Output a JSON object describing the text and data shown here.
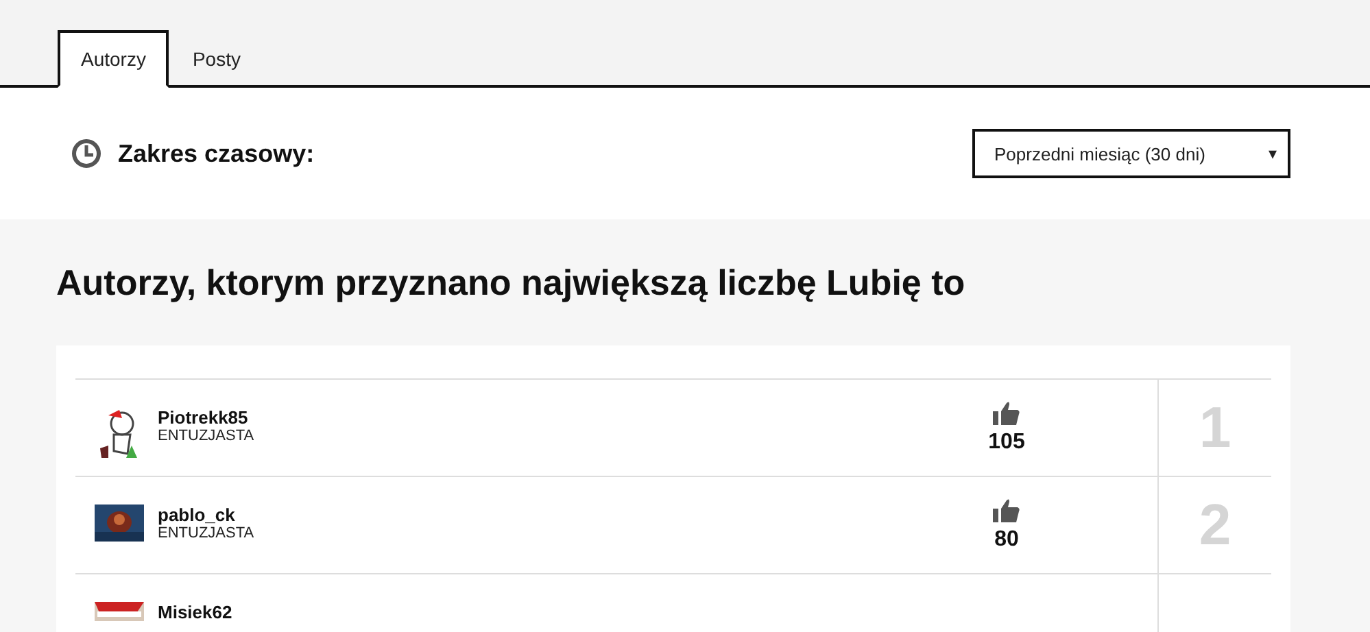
{
  "tabs": [
    {
      "label": "Autorzy",
      "selected": true
    },
    {
      "label": "Posty",
      "selected": false
    }
  ],
  "time_range": {
    "label": "Zakres czasowy:",
    "select_value": "Poprzedni miesiąc (30 dni)",
    "caret": "▾"
  },
  "heading": "Autorzy, ktorym przyznano największą liczbę Lubię to",
  "rows": [
    {
      "username": "Piotrekk85",
      "rank_label": "ENTUZJASTA",
      "likes": "105",
      "rank": "1"
    },
    {
      "username": "pablo_ck",
      "rank_label": "ENTUZJASTA",
      "likes": "80",
      "rank": "2"
    },
    {
      "username": "Misiek62"
    }
  ]
}
